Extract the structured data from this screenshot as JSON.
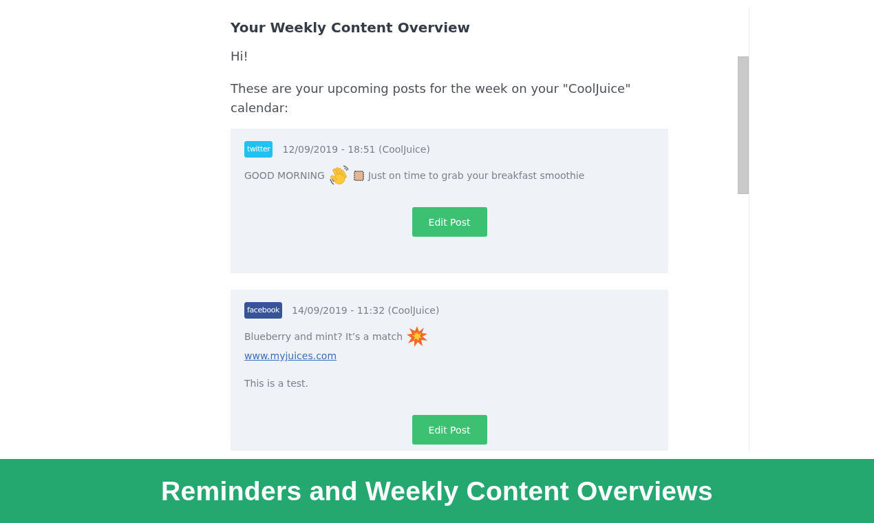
{
  "email": {
    "heading": "Your Weekly Content Overview",
    "greeting": "Hi!",
    "intro": "These are your upcoming posts for the week on your \"CoolJuice\" calendar:",
    "posts": [
      {
        "network": {
          "label": "twitter",
          "color": "#1ec3f3"
        },
        "schedule": "12/09/2019 - 18:51 (CoolJuice)",
        "paragraphs": [
          {
            "lines": [
              {
                "parts": [
                  {
                    "kind": "text",
                    "text": "GOOD MORNING"
                  },
                  {
                    "kind": "hand"
                  },
                  {
                    "kind": "swatch"
                  },
                  {
                    "kind": "text",
                    "text": "Just on time to grab your breakfast smoothie"
                  }
                ]
              }
            ]
          }
        ],
        "button": "Edit Post"
      },
      {
        "network": {
          "label": "facebook",
          "color": "#36539b"
        },
        "schedule": "14/09/2019 - 11:32 (CoolJuice)",
        "paragraphs": [
          {
            "lines": [
              {
                "parts": [
                  {
                    "kind": "text",
                    "text": "Blueberry and mint? It’s a match"
                  },
                  {
                    "kind": "burst"
                  }
                ]
              },
              {
                "parts": [
                  {
                    "kind": "link",
                    "text": "www.myjuices.com"
                  }
                ]
              }
            ]
          },
          {
            "lines": [
              {
                "parts": [
                  {
                    "kind": "text",
                    "text": "This is a test."
                  }
                ]
              }
            ]
          }
        ],
        "button": "Edit Post"
      }
    ]
  },
  "banner": {
    "title": "Reminders and Weekly Content Overviews"
  }
}
